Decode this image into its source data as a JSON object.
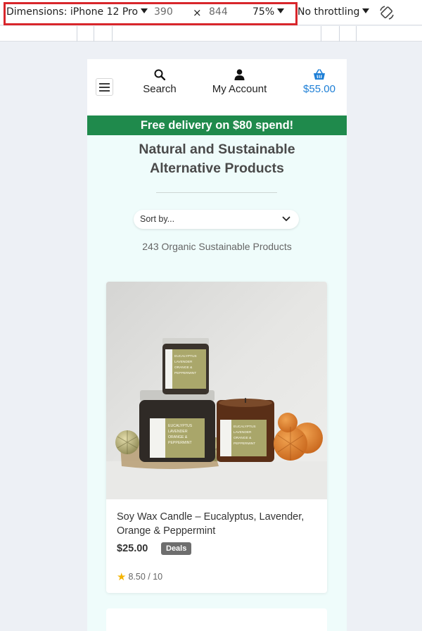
{
  "devtools": {
    "dimensions_label": "Dimensions: iPhone 12 Pro",
    "width": "390",
    "times": "×",
    "height": "844",
    "zoom": "75%",
    "throttling": "No throttling",
    "rotate_icon": "rotate-icon"
  },
  "header": {
    "search_label": "Search",
    "account_label": "My Account",
    "cart_total": "$55.00",
    "cart_color": "#1e7fd6",
    "icons": [
      "menu-icon",
      "search-icon",
      "user-icon",
      "basket-icon"
    ]
  },
  "banner": {
    "text": "Free delivery on $80 spend!",
    "color": "#1f8a4c"
  },
  "page": {
    "title_line1": "Natural and Sustainable",
    "title_line2": "Alternative Products",
    "sort_placeholder": "Sort by...",
    "product_count": "243 Organic Sustainable Products"
  },
  "product": {
    "name": "Soy Wax Candle – Eucalyptus, Lavender, Orange & Peppermint",
    "price": "$25.00",
    "badge": "Deals",
    "rating": "8.50 / 10"
  }
}
